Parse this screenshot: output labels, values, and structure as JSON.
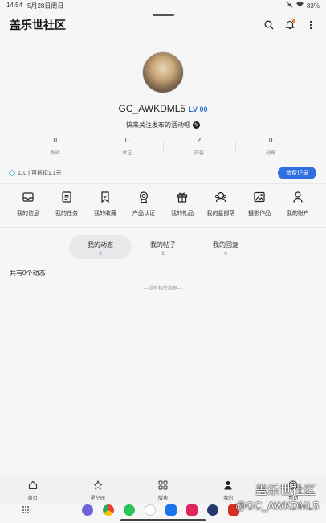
{
  "status_bar": {
    "time": "14:54",
    "date": "5月28日周日",
    "battery": "83%"
  },
  "header": {
    "title": "盖乐世社区"
  },
  "profile": {
    "username": "GC_AWKDML5",
    "level": "LV 00",
    "bio": "快来关注发布的活动吧"
  },
  "stats": [
    {
      "value": "0",
      "label": "粉丝"
    },
    {
      "value": "0",
      "label": "关注"
    },
    {
      "value": "2",
      "label": "内容"
    },
    {
      "value": "0",
      "label": "勋章"
    }
  ],
  "points": {
    "text": "110 | 可抵扣1.1元",
    "button": "消费记录"
  },
  "menu": [
    {
      "label": "我的信息",
      "icon": "mail-icon"
    },
    {
      "label": "我的任务",
      "icon": "task-list-icon"
    },
    {
      "label": "我的收藏",
      "icon": "bookmark-icon"
    },
    {
      "label": "产品认证",
      "icon": "badge-icon"
    },
    {
      "label": "我的礼品",
      "icon": "gift-icon"
    },
    {
      "label": "我的星部落",
      "icon": "group-icon"
    },
    {
      "label": "摄影作品",
      "icon": "image-icon"
    },
    {
      "label": "我的账户",
      "icon": "user-icon"
    }
  ],
  "tabs": [
    {
      "label": "我的动态",
      "count": "0"
    },
    {
      "label": "我的帖子",
      "count": "2"
    },
    {
      "label": "我的回复",
      "count": "0"
    }
  ],
  "feed": {
    "count_text": "共有0个动态",
    "empty_text": "---没有相关数据---"
  },
  "bottom_nav": [
    {
      "label": "首页",
      "icon": "home-icon"
    },
    {
      "label": "星空间",
      "icon": "star-icon"
    },
    {
      "label": "版块",
      "icon": "grid-icon"
    },
    {
      "label": "我的",
      "icon": "person-icon"
    },
    {
      "label": "帮助",
      "icon": "help-icon"
    }
  ],
  "watermark": {
    "title": "盖乐世社区",
    "user": "@GC_AWKDML5"
  },
  "colors": {
    "accent": "#2f6fe0",
    "background": "#f6f6f6"
  }
}
